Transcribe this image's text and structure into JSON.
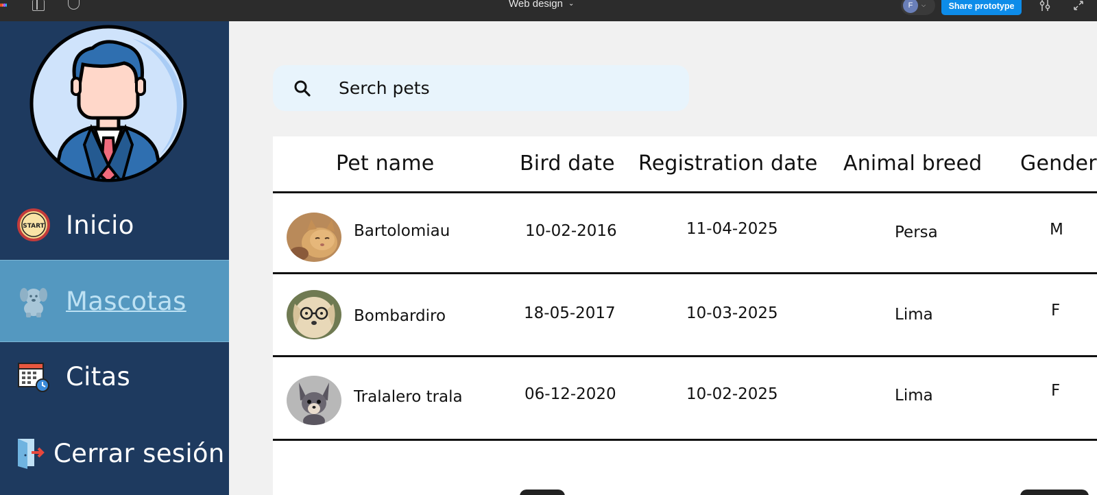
{
  "toolbar": {
    "file_title": "Web design",
    "avatar_initial": "F",
    "share_label": "Share prototype",
    "accent": "#0d8ce9"
  },
  "sidebar": {
    "background": "#1e3a5f",
    "active_background": "#5498c0",
    "profile_icon": "businessman-avatar-icon",
    "items": [
      {
        "label": "Inicio",
        "icon": "start-badge-icon",
        "active": false
      },
      {
        "label": " Mascotas",
        "icon": "dog-icon",
        "active": true
      },
      {
        "label": "Citas",
        "icon": "calendar-clock-icon",
        "active": false
      },
      {
        "label": "Cerrar sesión",
        "icon": "logout-door-icon",
        "active": false
      }
    ]
  },
  "search": {
    "placeholder": "Serch pets",
    "icon": "search-icon",
    "background": "#e8f4fc"
  },
  "table": {
    "columns": [
      "Pet name",
      "Bird date",
      "Registration date",
      "Animal breed",
      "Gender"
    ],
    "rows": [
      {
        "photo": "cat-photo",
        "name": "Bartolomiau",
        "birth": "10-02-2016",
        "registration": "11-04-2025",
        "breed": "Persa",
        "gender": "M"
      },
      {
        "photo": "dog-glasses-photo",
        "name": "Bombardiro",
        "birth": "18-05-2017",
        "registration": "10-03-2025",
        "breed": "Lima",
        "gender": "F"
      },
      {
        "photo": "chihuahua-photo",
        "name": "Tralalero trala",
        "birth": "06-12-2020",
        "registration": "10-02-2025",
        "breed": "Lima",
        "gender": "F"
      }
    ]
  },
  "start_badge_text": "START"
}
